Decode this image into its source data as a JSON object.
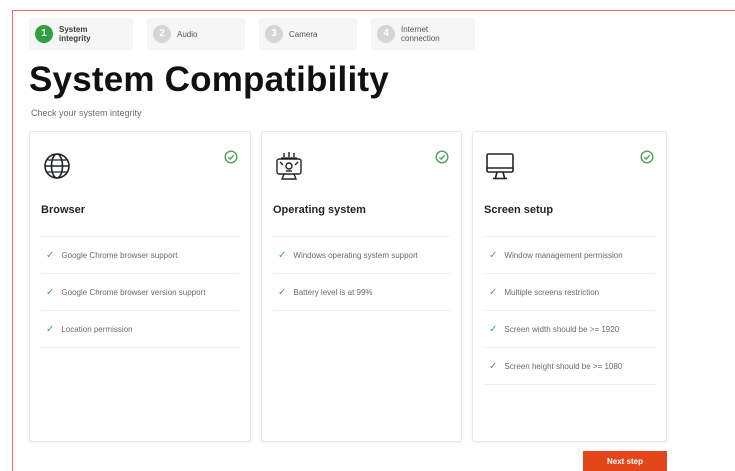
{
  "stepper": {
    "steps": [
      {
        "number": "1",
        "label_line1": "System",
        "label_line2": "integrity",
        "state": "active"
      },
      {
        "number": "2",
        "label_line1": "Audio",
        "label_line2": "",
        "state": "inactive"
      },
      {
        "number": "3",
        "label_line1": "Camera",
        "label_line2": "",
        "state": "inactive"
      },
      {
        "number": "4",
        "label_line1": "Internet",
        "label_line2": "connection",
        "state": "inactive"
      }
    ]
  },
  "page": {
    "title": "System Compatibility",
    "subtitle": "Check your system integrity"
  },
  "cards": [
    {
      "icon": "globe-icon",
      "status": "check-circle-icon",
      "title": "Browser",
      "items": [
        "Google Chrome browser support",
        "Google Chrome browser version support",
        "Location permission"
      ]
    },
    {
      "icon": "operating-system-icon",
      "status": "check-circle-icon",
      "title": "Operating system",
      "items": [
        "Windows operating system support",
        "Battery level is at 99%"
      ]
    },
    {
      "icon": "monitor-icon",
      "status": "check-circle-icon",
      "title": "Screen setup",
      "items": [
        "Window management permission",
        "Multiple screens restriction",
        "Screen width should be >= 1920",
        "Screen height should be >= 1080"
      ]
    }
  ],
  "footer": {
    "next_label": "Next step"
  },
  "colors": {
    "accent": "#e3461a",
    "success": "#2ea043",
    "frame": "#ee6a5c"
  }
}
